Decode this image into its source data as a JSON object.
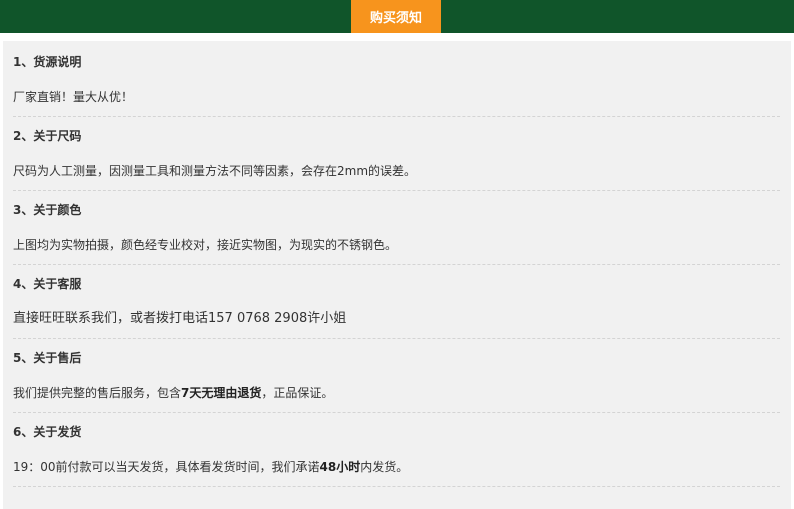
{
  "header": {
    "title": "购买须知"
  },
  "sections": [
    {
      "title": "1、货源说明",
      "body": " 厂家直销！量大从优！"
    },
    {
      "title": "2、关于尺码",
      "body": "尺码为人工测量，因测量工具和测量方法不同等因素，会存在2mm的误差。"
    },
    {
      "title": "3、关于颜色",
      "body": "上图均为实物拍摄，颜色经专业校对，接近实物图，为现实的不锈钢色。"
    },
    {
      "title": "4、关于客服",
      "body": "直接旺旺联系我们，或者拨打电话157  0768  2908许小姐"
    },
    {
      "title": "5、关于售后",
      "body_pre": " 我们提供完整的售后服务，包含",
      "body_bold": "7天无理由退货",
      "body_post": "，正品保证。"
    },
    {
      "title": "6、关于发货",
      "body_pre": " 19：00前付款可以当天发货，具体看发货时间，我们承诺",
      "body_bold": "48小时",
      "body_post": "内发货。"
    }
  ]
}
